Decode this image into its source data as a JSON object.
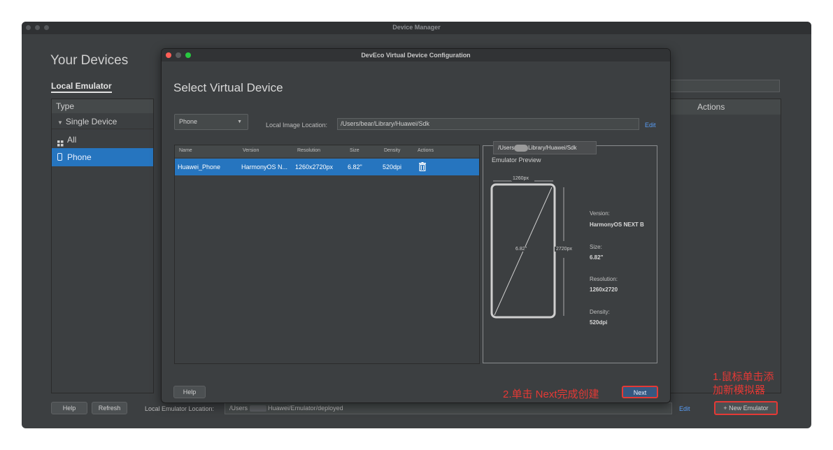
{
  "main_window": {
    "title": "Device Manager",
    "heading": "Your Devices",
    "tab": "Local Emulator",
    "left_panel": {
      "header": "Type",
      "group": "Single Device",
      "items": [
        {
          "label": "All",
          "icon": "grid-icon"
        },
        {
          "label": "Phone",
          "icon": "phone-icon",
          "selected": true
        }
      ]
    },
    "right_panel": {
      "header": "Actions"
    },
    "footer": {
      "help_label": "Help",
      "refresh_label": "Refresh",
      "location_label": "Local Emulator Location:",
      "location_value_prefix": "/Users",
      "location_value_suffix": "Huawei/Emulator/deployed",
      "edit_label": "Edit",
      "new_emulator_label": "+ New Emulator"
    }
  },
  "dialog": {
    "title": "DevEco Virtual Device Configuration",
    "heading": "Select Virtual Device",
    "category": "Phone",
    "image_location_label": "Local Image Location:",
    "image_location_value": "/Users/bear/Library/Huawei/Sdk",
    "edit_label": "Edit",
    "table": {
      "columns": [
        "Name",
        "Version",
        "Resolution",
        "Size",
        "Density",
        "Actions"
      ],
      "rows": [
        {
          "name": "Huawei_Phone",
          "version": "HarmonyOS N...",
          "resolution": "1260x2720px",
          "size": "6.82\"",
          "density": "520dpi",
          "selected": true
        }
      ]
    },
    "tooltip": {
      "prefix": "/Users",
      "suffix": "Library/Huawei/Sdk"
    },
    "preview": {
      "title": "Emulator Preview",
      "width_label": "1260px",
      "height_label": "2720px",
      "diagonal_label": "6.82\"",
      "specs": [
        {
          "label": "Version:",
          "value": "HarmonyOS NEXT B"
        },
        {
          "label": "Size:",
          "value": "6.82\""
        },
        {
          "label": "Resolution:",
          "value": "1260x2720"
        },
        {
          "label": "Density:",
          "value": "520dpi"
        }
      ]
    },
    "help_label": "Help",
    "next_label": "Next"
  },
  "annotations": {
    "note1_line1": "1.鼠标单击添",
    "note1_line2": "加新模拟器",
    "note2": "2.单击 Next完成创建",
    "color": "#e53935"
  },
  "colors": {
    "window_bg": "#3c3f41",
    "selection": "#2675bf",
    "link": "#589df6",
    "traffic_red": "#ff5f57",
    "traffic_yellow": "#febc2e",
    "traffic_green": "#28c840"
  }
}
